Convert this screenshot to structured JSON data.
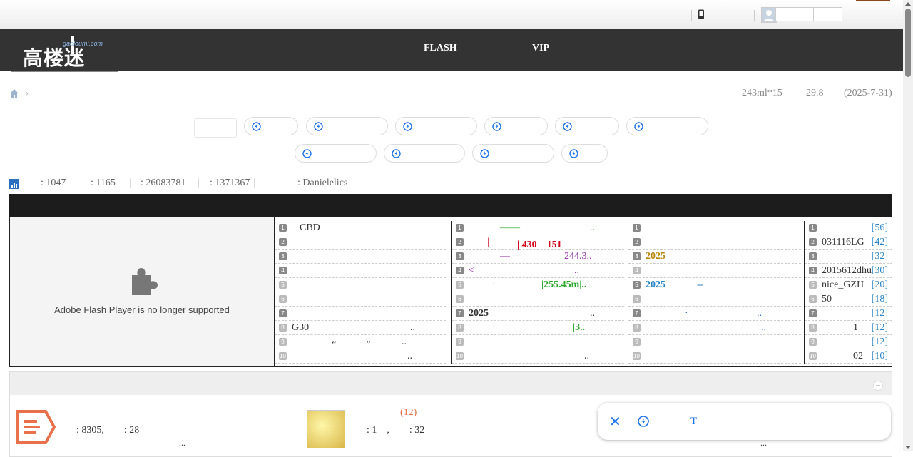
{
  "site": {
    "logo_text": "高楼迷",
    "logo_url_text": "gaoloumi.com"
  },
  "nav": {
    "items": [
      {
        "label": "FLASH"
      },
      {
        "label": "VIP"
      }
    ]
  },
  "breadcrumb": {
    "sep": "›",
    "right": [
      "243ml*15",
      "29.8",
      "(2025-7-31)"
    ]
  },
  "stats": {
    "items": [
      ": 1047",
      ": 1165",
      ": 26083781",
      ": 1371367",
      ": Danielelics"
    ]
  },
  "flash": {
    "message": "Adobe Flash Player is no longer supported"
  },
  "col1": [
    {
      "n": "1",
      "t": "CBD"
    },
    {
      "n": "2",
      "t": ""
    },
    {
      "n": "3",
      "t": ""
    },
    {
      "n": "4",
      "t": ""
    },
    {
      "n": "5",
      "t": ""
    },
    {
      "n": "6",
      "t": ""
    },
    {
      "n": "7",
      "t": ""
    },
    {
      "n": "8",
      "t": "G30"
    },
    {
      "n": "9",
      "t": "“　　　”"
    },
    {
      "n": "10",
      "t": ""
    }
  ],
  "col1_tail": {
    "r8": "..",
    "r9": "..",
    "r10": ".."
  },
  "col2": [
    {
      "n": "1",
      "a": "——",
      "b": ".."
    },
    {
      "n": "2",
      "a": "|",
      "b": "| 430　151"
    },
    {
      "n": "3",
      "a": "—",
      "b": "244.3.."
    },
    {
      "n": "4",
      "a": "<",
      "b": ".."
    },
    {
      "n": "5",
      "a": "·",
      "b": "|255.45m|.."
    },
    {
      "n": "6",
      "a": "",
      "b": "|"
    },
    {
      "n": "7",
      "a": "2025",
      "b": ".."
    },
    {
      "n": "8",
      "a": "·",
      "b": "|3.."
    },
    {
      "n": "9",
      "a": "",
      "b": ""
    },
    {
      "n": "10",
      "a": "",
      "b": ".."
    }
  ],
  "col3": [
    {
      "n": "1",
      "a": "",
      "b": ""
    },
    {
      "n": "2",
      "a": "",
      "b": ""
    },
    {
      "n": "3",
      "a": "2025",
      "b": ""
    },
    {
      "n": "4",
      "a": "",
      "b": ""
    },
    {
      "n": "5",
      "a": "2025",
      "b": "--"
    },
    {
      "n": "6",
      "a": "",
      "b": ""
    },
    {
      "n": "7",
      "a": "·",
      "b": ".."
    },
    {
      "n": "8",
      "a": "",
      "b": ".."
    },
    {
      "n": "9",
      "a": "",
      "b": ""
    },
    {
      "n": "10",
      "a": "",
      "b": ""
    }
  ],
  "col4": [
    {
      "n": "1",
      "t": "",
      "c": "[56]"
    },
    {
      "n": "2",
      "t": "031116LG",
      "c": "[42]"
    },
    {
      "n": "3",
      "t": "",
      "c": "[32]"
    },
    {
      "n": "4",
      "t": "2015612dhu",
      "c": "[30]"
    },
    {
      "n": "5",
      "t": "nice_GZH",
      "c": "[20]"
    },
    {
      "n": "6",
      "t": "50",
      "c": "[18]"
    },
    {
      "n": "7",
      "t": "",
      "c": "[12]"
    },
    {
      "n": "8",
      "t": "1",
      "c": "[12]"
    },
    {
      "n": "9",
      "t": "",
      "c": "[12]"
    },
    {
      "n": "10",
      "t": "02",
      "c": "[10]"
    }
  ],
  "lower": {
    "a_stats": ": 8305,　　: 28",
    "a_more": "...",
    "b_count": "(12)",
    "b_stats": ": 1　,　　: 32",
    "c_more": "..."
  },
  "float_toolbar": {
    "close": "✕",
    "t_label": "T"
  },
  "colors": {
    "accent_blue": "#2a86c8",
    "red": "#d0021b",
    "purple": "#9b2fae",
    "green": "#2ea82e",
    "gold": "#b8860b"
  }
}
